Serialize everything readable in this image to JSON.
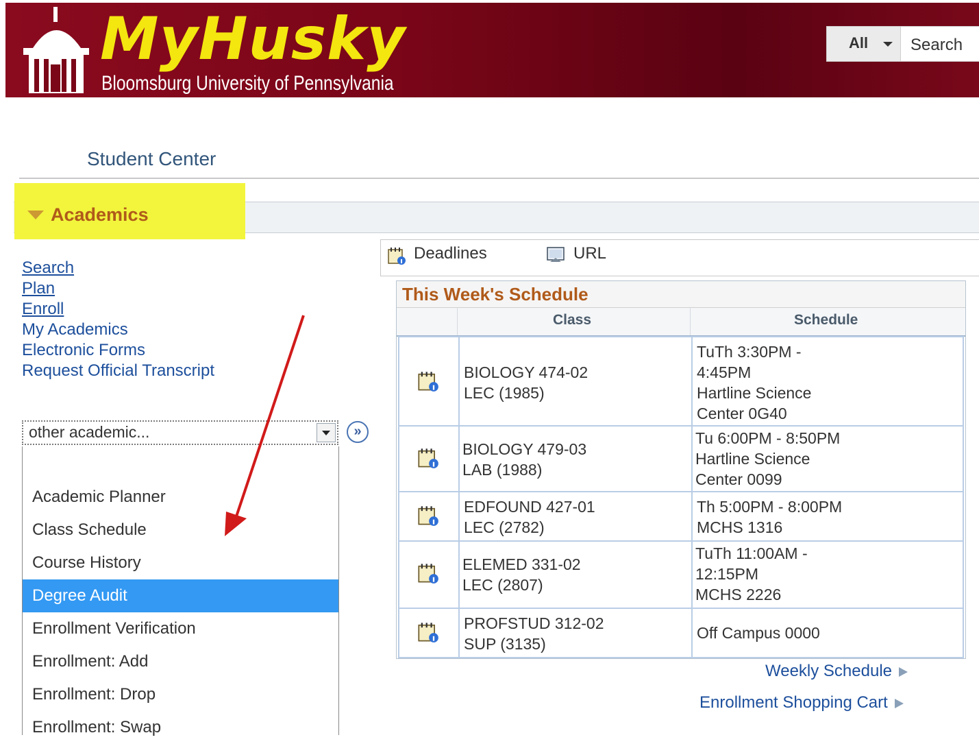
{
  "header": {
    "brand": "MyHusky",
    "subtitle": "Bloomsburg University of Pennsylvania",
    "search_scope": "All",
    "search_placeholder": "Search"
  },
  "page_title": "Student Center",
  "section": {
    "label": "Academics"
  },
  "left_links": [
    "Search",
    "Plan",
    "Enroll",
    "My Academics",
    "Electronic Forms",
    "Request Official Transcript"
  ],
  "dropdown": {
    "selected": "other academic...",
    "options": [
      "Academic Planner",
      "Class Schedule",
      "Course History",
      "Degree Audit",
      "Enrollment Verification",
      "Enrollment: Add",
      "Enrollment: Drop",
      "Enrollment: Swap"
    ],
    "highlighted": "Degree Audit"
  },
  "toolbar": {
    "deadlines": "Deadlines",
    "url": "URL"
  },
  "schedule": {
    "title": "This Week's Schedule",
    "col_class": "Class",
    "col_schedule": "Schedule",
    "rows": [
      {
        "class_l1": "BIOLOGY 474-02",
        "class_l2": "LEC (1985)",
        "sched_l1": "TuTh 3:30PM -",
        "sched_l2": "4:45PM",
        "sched_l3": "Hartline Science",
        "sched_l4": "Center 0G40"
      },
      {
        "class_l1": "BIOLOGY 479-03",
        "class_l2": "LAB (1988)",
        "sched_l1": "Tu 6:00PM - 8:50PM",
        "sched_l2": "Hartline Science",
        "sched_l3": "Center 0099"
      },
      {
        "class_l1": "EDFOUND 427-01",
        "class_l2": "LEC (2782)",
        "sched_l1": "Th 5:00PM - 8:00PM",
        "sched_l2": "MCHS 1316"
      },
      {
        "class_l1": "ELEMED 331-02",
        "class_l2": "LEC (2807)",
        "sched_l1": "TuTh 11:00AM -",
        "sched_l2": "12:15PM",
        "sched_l3": "MCHS 2226"
      },
      {
        "class_l1": "PROFSTUD 312-02",
        "class_l2": "SUP (3135)",
        "sched_l1": "Off Campus 0000"
      }
    ]
  },
  "links": {
    "weekly": "Weekly Schedule",
    "cart": "Enrollment Shopping Cart"
  },
  "colors": {
    "banner": "#7a0618",
    "brand_yellow": "#f4e60f",
    "link_blue": "#1d4f9c",
    "section_orange": "#b05a1a",
    "highlight_yellow": "#f2f53c",
    "selected_blue": "#3399f3"
  }
}
